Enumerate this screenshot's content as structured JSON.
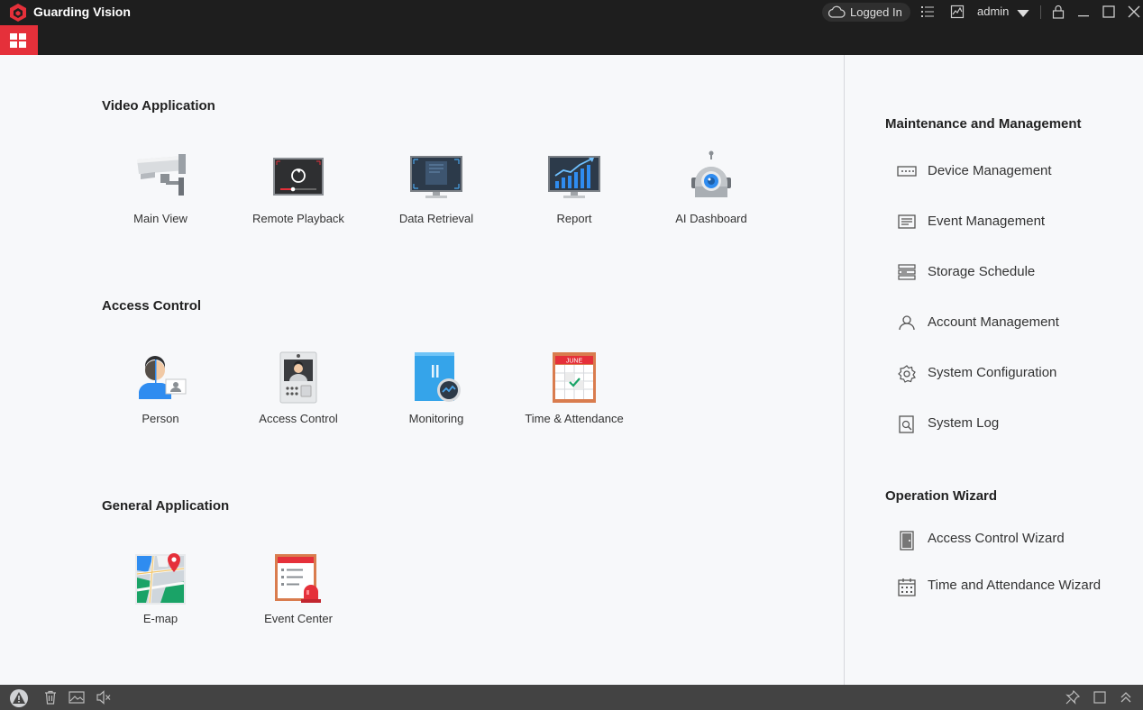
{
  "app": {
    "title": "Guarding Vision"
  },
  "titlebar": {
    "login_status": "Logged In",
    "user": "admin"
  },
  "sections": {
    "video": {
      "title": "Video Application",
      "items": [
        {
          "label": "Main View",
          "icon": "camera-icon"
        },
        {
          "label": "Remote Playback",
          "icon": "playback-icon"
        },
        {
          "label": "Data Retrieval",
          "icon": "data-retrieval-icon"
        },
        {
          "label": "Report",
          "icon": "report-icon"
        },
        {
          "label": "AI Dashboard",
          "icon": "ai-dashboard-icon"
        }
      ]
    },
    "access": {
      "title": "Access Control",
      "items": [
        {
          "label": "Person",
          "icon": "person-icon"
        },
        {
          "label": "Access Control",
          "icon": "access-control-icon"
        },
        {
          "label": "Monitoring",
          "icon": "monitoring-icon"
        },
        {
          "label": "Time & Attendance",
          "icon": "calendar-icon",
          "calendar_month": "JUNE"
        }
      ]
    },
    "general": {
      "title": "General Application",
      "items": [
        {
          "label": "E-map",
          "icon": "map-icon"
        },
        {
          "label": "Event Center",
          "icon": "event-center-icon"
        }
      ]
    }
  },
  "right_panel": {
    "maintenance": {
      "title": "Maintenance and Management",
      "items": [
        {
          "label": "Device Management",
          "icon": "device-icon"
        },
        {
          "label": "Event Management",
          "icon": "event-list-icon"
        },
        {
          "label": "Storage Schedule",
          "icon": "storage-icon"
        },
        {
          "label": "Account Management",
          "icon": "user-icon"
        },
        {
          "label": "System Configuration",
          "icon": "gear-icon"
        },
        {
          "label": "System Log",
          "icon": "log-icon"
        }
      ]
    },
    "wizard": {
      "title": "Operation Wizard",
      "items": [
        {
          "label": "Access Control Wizard",
          "icon": "door-icon"
        },
        {
          "label": "Time and Attendance Wizard",
          "icon": "calendar-small-icon"
        }
      ]
    }
  },
  "colors": {
    "accent": "#e5303a",
    "titlebar": "#1e1e1e",
    "statusbar": "#434343",
    "background": "#f7f8fa"
  }
}
